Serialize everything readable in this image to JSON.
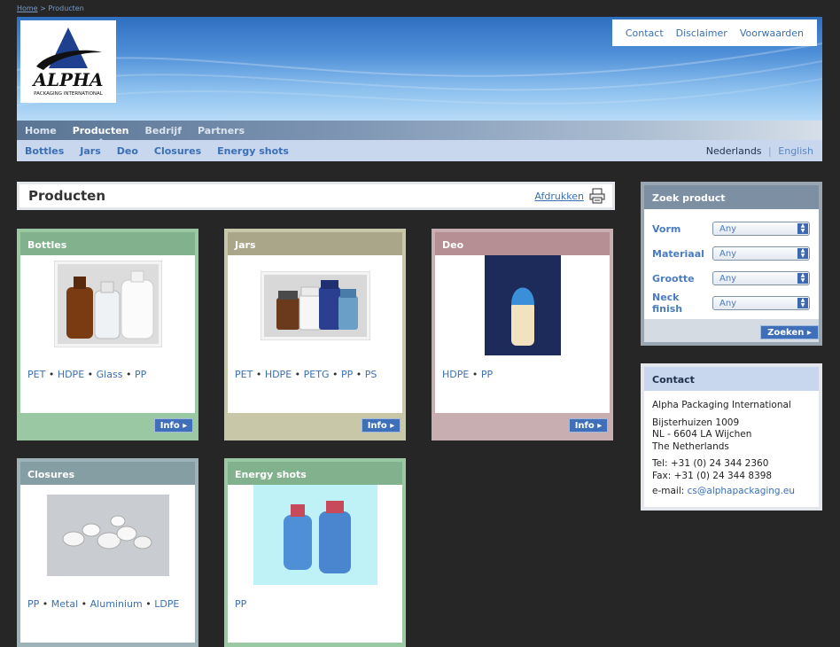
{
  "breadcrumb": {
    "home": "Home",
    "sep": ">",
    "current": "Producten"
  },
  "toplinks": [
    "Contact",
    "Disclaimer",
    "Voorwaarden"
  ],
  "logo": {
    "brand": "ALPHA",
    "sub": "PACKAGING INTERNATIONAL"
  },
  "mainnav": [
    "Home",
    "Producten",
    "Bedrijf",
    "Partners"
  ],
  "subnav": [
    "Bottles",
    "Jars",
    "Deo",
    "Closures",
    "Energy shots"
  ],
  "languages": {
    "current": "Nederlands",
    "sep": "|",
    "other": "English"
  },
  "page": {
    "title": "Producten",
    "print_label": "Afdrukken"
  },
  "products": [
    {
      "name": "Bottles",
      "materials": [
        "PET",
        "HDPE",
        "Glass",
        "PP"
      ],
      "info": "Info"
    },
    {
      "name": "Jars",
      "materials": [
        "PET",
        "HDPE",
        "PETG",
        "PP",
        "PS"
      ],
      "info": "Info"
    },
    {
      "name": "Deo",
      "materials": [
        "HDPE",
        "PP"
      ],
      "info": "Info"
    },
    {
      "name": "Closures",
      "materials": [
        "PP",
        "Metal",
        "Aluminium",
        "LDPE"
      ]
    },
    {
      "name": "Energy shots",
      "materials": [
        "PP"
      ]
    }
  ],
  "search": {
    "title": "Zoek product",
    "fields": [
      {
        "label": "Vorm",
        "value": "Any"
      },
      {
        "label": "Materiaal",
        "value": "Any"
      },
      {
        "label": "Grootte",
        "value": "Any"
      },
      {
        "label": "Neck finish",
        "value": "Any"
      }
    ],
    "button": "Zoeken"
  },
  "contact": {
    "title": "Contact",
    "company": "Alpha Packaging International",
    "address1": "Bijsterhuizen 1009",
    "address2": "NL - 6604 LA Wijchen",
    "country": "The Netherlands",
    "tel": "Tel: +31 (0) 24 344 2360",
    "fax": "Fax: +31 (0) 24 344 8398",
    "email_label": "e-mail:",
    "email": "cs@alphapackaging.eu"
  },
  "colors": {
    "page_bg": "#262626",
    "link": "#3a6fb5",
    "button": "#3f6fb8"
  }
}
